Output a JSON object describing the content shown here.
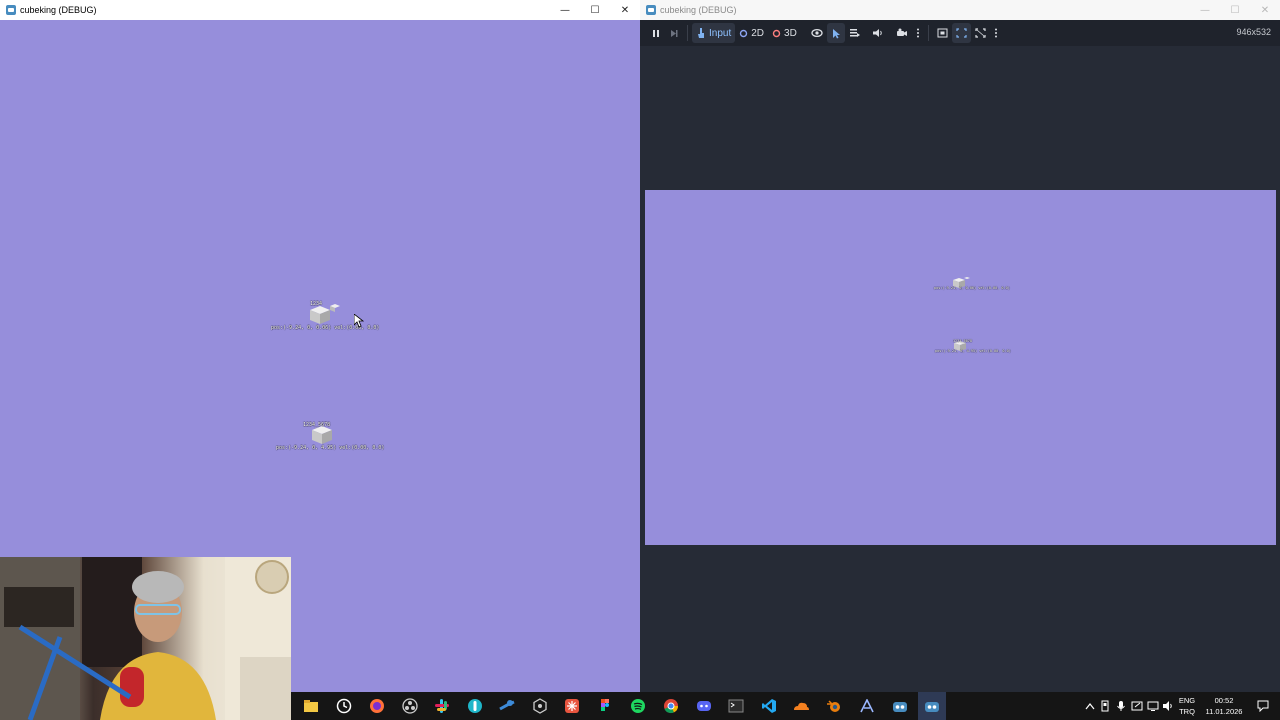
{
  "left_window": {
    "title": "cubeking (DEBUG)",
    "controls": [
      "—",
      "☐",
      "✕"
    ],
    "cube1_label": "pos:(-9.24, 0, 0.06) vel:(0.00, 0.0)",
    "cube1_name": "1234",
    "cube2_label": "pos:(-9.24, 0, 4.95) vel:(0.00, 0.0)",
    "cube2_name": "1234_5678"
  },
  "right_window": {
    "title": "cubeking (DEBUG)",
    "controls": [
      "—",
      "☐",
      "✕"
    ],
    "toolbar": {
      "input_label": "Input",
      "mode_2d": "2D",
      "mode_3d": "3D"
    },
    "resolution": "946x532"
  },
  "taskbar": {
    "lang_top": "ENG",
    "lang_bottom": "TRQ",
    "time": "00:52",
    "date": "11.01.2026"
  },
  "colors": {
    "game_bg": "#968edb",
    "editor_bg": "#262b36",
    "accent": "#478cbf"
  }
}
